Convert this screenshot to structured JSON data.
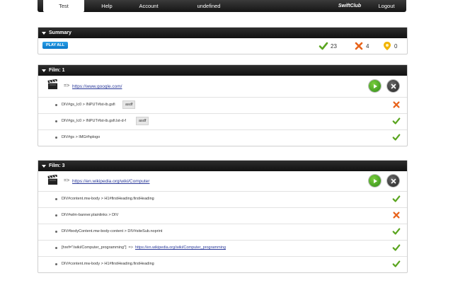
{
  "nav": {
    "tabs": [
      "Test",
      "Help",
      "Account",
      "undefined"
    ],
    "brand": "SwiftClub",
    "logout": "Logout"
  },
  "summary": {
    "title": "Summary",
    "play_all": "PLAY ALL",
    "passed": "23",
    "failed": "4",
    "pending": "0"
  },
  "film1": {
    "title": "Film: 1",
    "arrow": "=>",
    "url": "https://www.google.com/",
    "steps": [
      {
        "selector": "DIV#gs_lc0 > INPUT#lst-ib.gsfi",
        "value": "asdf",
        "status": "fail"
      },
      {
        "selector": "DIV#gs_lc0 > INPUT#lst-ib.gsfi.lst-d-f",
        "value": "asdf",
        "status": "pass"
      },
      {
        "selector": "DIV#gs > IMG#hplogo",
        "value": "",
        "status": "pass"
      }
    ]
  },
  "film3": {
    "title": "Film: 3",
    "arrow": "=>",
    "url": "https://en.wikipedia.org/wiki/Computer",
    "steps": [
      {
        "selector": "DIV#content.mw-body > H1#firstHeading.firstHeading",
        "status": "pass"
      },
      {
        "selector": "DIV#wlm-banner.plainlinks > DIV",
        "status": "fail"
      },
      {
        "selector": "DIV#bodyContent.mw-body-content > DIV#siteSub.noprint",
        "status": "pass"
      },
      {
        "selector": "[href=\"/wiki/Computer_programming\"]",
        "arrow": "=>",
        "url": "https://en.wikipedia.org/wiki/Computer_programming",
        "status": "pass"
      },
      {
        "selector": "DIV#content.mw-body > H1#firstHeading.firstHeading",
        "status": "pass"
      }
    ]
  },
  "colors": {
    "nav_bg": "#1e1e1e",
    "accent_blue": "#0a78c9",
    "pass_green": "#5aa51f",
    "fail_orange": "#e8641c",
    "warn_yellow": "#f2b400"
  }
}
